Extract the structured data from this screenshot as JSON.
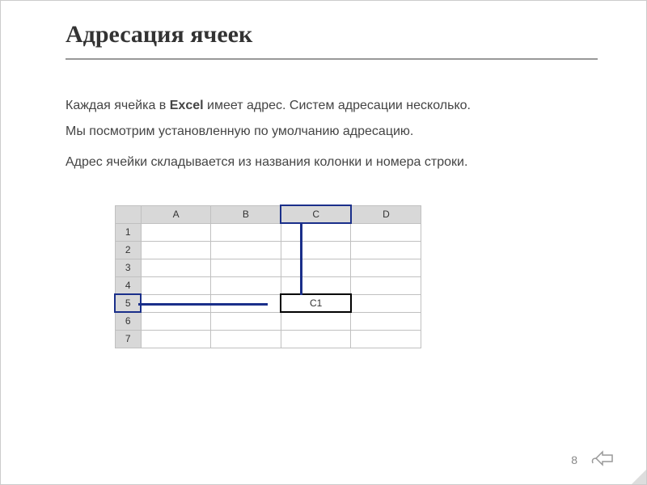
{
  "title": "Адресация ячеек",
  "paragraph1_part1": "Каждая ячейка в ",
  "paragraph1_bold": "Excel",
  "paragraph1_part2": " имеет адрес. Систем адресации несколько.",
  "paragraph2": "Мы посмотрим установленную по умолчанию адресацию.",
  "paragraph3": "Адрес ячейки складывается из названия колонки и номера строки.",
  "excel": {
    "columns": [
      "A",
      "B",
      "C",
      "D"
    ],
    "rows": [
      "1",
      "2",
      "3",
      "4",
      "5",
      "6",
      "7"
    ],
    "selected_cell_value": "C1"
  },
  "page_number": "8"
}
